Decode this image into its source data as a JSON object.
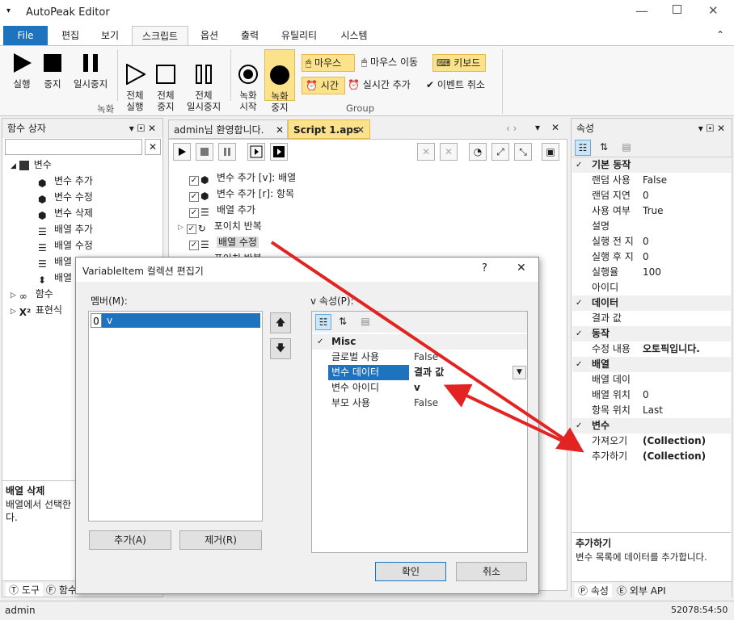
{
  "window": {
    "title": "AutoPeak Editor"
  },
  "menu_tabs": [
    "File",
    "편집",
    "보기",
    "스크립트",
    "옵션",
    "출력",
    "유틸리티",
    "시스템"
  ],
  "ribbon": {
    "run": "실행",
    "stop": "중지",
    "pause": "일시중지",
    "all_run": "전체\n실행",
    "all_stop": "전체\n중지",
    "all_pause": "전체\n일시중지",
    "rec_start": "녹화\n시작",
    "rec_stop": "녹화\n중지",
    "mouse": "마우스",
    "mouse_move": "마우스 이동",
    "keyboard": "키보드",
    "time": "시간",
    "realtime_add": "실시간 추가",
    "event_cancel": "이벤트 취소",
    "group_record": "녹화",
    "group_group": "Group"
  },
  "left_panel": {
    "title": "함수 상자",
    "tree": {
      "variables": "변수",
      "var_add": "변수 추가",
      "var_edit": "변수 수정",
      "var_delete": "변수 삭제",
      "arr_add": "배열 추가",
      "arr_edit": "배열 수정",
      "arr_x": "배열",
      "arr_y": "배열",
      "functions": "함수",
      "expression": "표현식"
    },
    "desc_title": "배열 삭제",
    "desc_text": "배열에서 선택한\n다.",
    "tab_tools": "도구",
    "tab_functions": "함수"
  },
  "doc_tabs": {
    "welcome": "admin님 환영합니다.",
    "script": "Script 1.aps"
  },
  "script_lines": [
    "변수 추가 [v]: 배열",
    "변수 추가 [r]: 항목",
    "배열 추가",
    "포이치 반복",
    "배열 수정",
    "포이치 반복"
  ],
  "right_panel": {
    "title": "속성",
    "categories": {
      "basic": "기본 동작",
      "data": "데이터",
      "action": "동작",
      "array": "배열",
      "variable": "변수"
    },
    "props": {
      "random_use_k": "랜덤 사용",
      "random_use_v": "False",
      "random_delay_k": "랜덤 지연",
      "random_delay_v": "0",
      "use_k": "사용 여부",
      "use_v": "True",
      "desc_k": "설명",
      "pre_delay_k": "실행 전 지",
      "pre_delay_v": "0",
      "post_delay_k": "실행 후 지",
      "post_delay_v": "0",
      "rate_k": "실행율",
      "rate_v": "100",
      "id_k": "아이디",
      "result_k": "결과 값",
      "edit_k": "수정 내용",
      "edit_v": "오토픽입니다.",
      "arr_data_k": "배열 데이",
      "arr_pos_k": "배열 위치",
      "arr_pos_v": "0",
      "item_pos_k": "항목 위치",
      "item_pos_v": "Last",
      "get_k": "가져오기",
      "get_v": "(Collection)",
      "add_k": "추가하기",
      "add_v": "(Collection)"
    },
    "desc_title": "추가하기",
    "desc_text": "변수 목록에 데이터를 추가합니다.",
    "tab_props": "속성",
    "tab_api": "외부 API"
  },
  "dialog": {
    "title": "VariableItem 컬렉션 편집기",
    "help": "?",
    "close": "✕",
    "members_label": "멤버(M):",
    "members": [
      {
        "index": "0",
        "name": "v"
      }
    ],
    "props_label": "v 속성(P):",
    "misc": "Misc",
    "rows": [
      {
        "k": "글로벌 사용",
        "v": "False"
      },
      {
        "k": "변수 데이터",
        "v": "결과 값"
      },
      {
        "k": "변수 아이디",
        "v": "v"
      },
      {
        "k": "부모 사용",
        "v": "False"
      }
    ],
    "add_btn": "추가(A)",
    "remove_btn": "제거(R)",
    "ok_btn": "확인",
    "cancel_btn": "취소"
  },
  "status": {
    "user": "admin",
    "time": "52078:54:50"
  },
  "colors": {
    "accent": "#1e73be",
    "arrow": "#e32322",
    "highlight": "#fce28a"
  }
}
